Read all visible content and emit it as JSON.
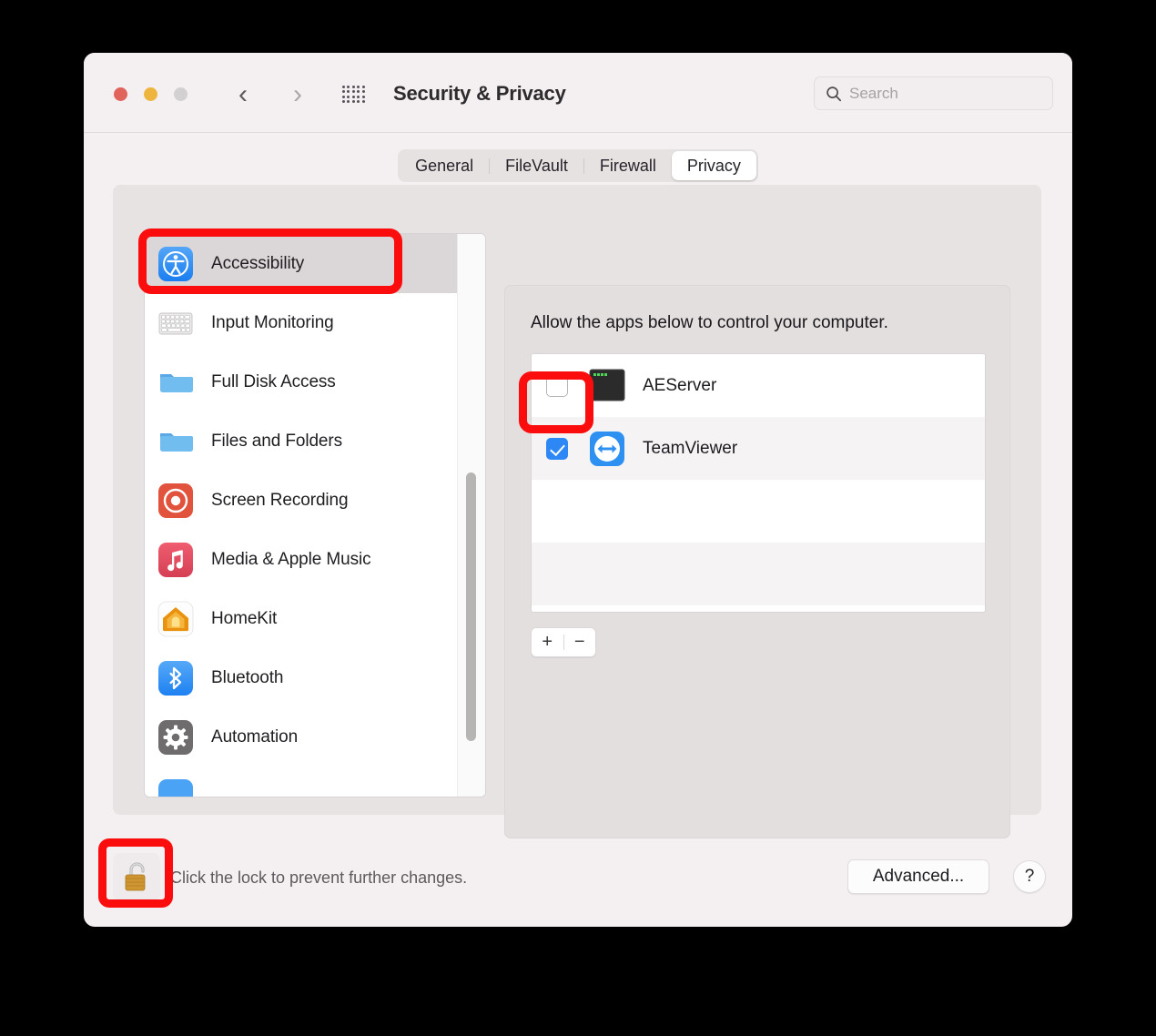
{
  "window": {
    "title": "Security & Privacy",
    "traffic_lights": [
      "close",
      "minimize",
      "zoom"
    ],
    "back_label": "‹",
    "forward_label": "›",
    "grid_icon": "grid-view-icon"
  },
  "search": {
    "placeholder": "Search",
    "value": "",
    "icon": "search-icon"
  },
  "tabs": [
    {
      "label": "General",
      "selected": false
    },
    {
      "label": "FileVault",
      "selected": false
    },
    {
      "label": "Firewall",
      "selected": false
    },
    {
      "label": "Privacy",
      "selected": true
    }
  ],
  "sidebar": {
    "items": [
      {
        "label": "Accessibility",
        "icon": "accessibility-icon",
        "selected": true
      },
      {
        "label": "Input Monitoring",
        "icon": "keyboard-icon",
        "selected": false
      },
      {
        "label": "Full Disk Access",
        "icon": "folder-icon",
        "selected": false
      },
      {
        "label": "Files and Folders",
        "icon": "folder-icon",
        "selected": false
      },
      {
        "label": "Screen Recording",
        "icon": "screen-recording-icon",
        "selected": false
      },
      {
        "label": "Media & Apple Music",
        "icon": "music-note-icon",
        "selected": false
      },
      {
        "label": "HomeKit",
        "icon": "home-icon",
        "selected": false
      },
      {
        "label": "Bluetooth",
        "icon": "bluetooth-icon",
        "selected": false
      },
      {
        "label": "Automation",
        "icon": "gear-icon",
        "selected": false
      },
      {
        "label": "",
        "icon": "app-management-icon",
        "selected": false
      }
    ],
    "scrollbar": "vertical-scrollbar"
  },
  "main": {
    "description": "Allow the apps below to control your computer.",
    "apps": [
      {
        "name": "AEServer",
        "checked": false,
        "icon": "terminal-icon"
      },
      {
        "name": "TeamViewer",
        "checked": true,
        "icon": "teamviewer-icon"
      }
    ],
    "add_label": "+",
    "remove_label": "−"
  },
  "bottom": {
    "lock_icon": "unlocked-padlock-icon",
    "lock_text": "Click the lock to prevent further changes.",
    "advanced_label": "Advanced...",
    "help_label": "?"
  },
  "annotations": {
    "color": "#fc0d0d",
    "highlights": [
      "accessibility-sidebar-item",
      "teamviewer-checkbox",
      "lock-button"
    ]
  }
}
